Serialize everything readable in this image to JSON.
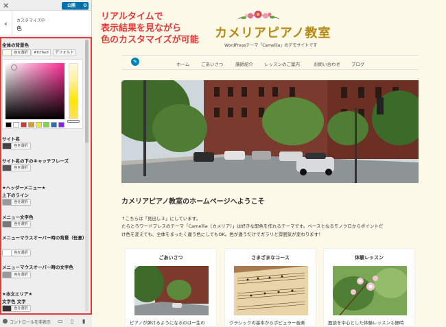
{
  "customizer": {
    "publish_label": "公開",
    "breadcrumb": "カスタマイズ中",
    "section_title": "色",
    "collapse_label": "コントロールを非表示",
    "picker_swatch_label": "色を選択",
    "hex_value": "#fcf9e8",
    "default_label": "デフォルト",
    "palette_colors": [
      "#000000",
      "#ffffff",
      "#dd3333",
      "#dd9933",
      "#eeee22",
      "#81d742",
      "#1e73be",
      "#8224e3"
    ],
    "controls": [
      {
        "label": "全体の背景色",
        "color": "#fcf9e8"
      },
      {
        "label": "サイト名",
        "color": "#444444"
      },
      {
        "label": "サイト名の下のキャッチフレーズ",
        "color": "#555555"
      },
      {
        "label": "★ヘッダーメニュー★",
        "color": null
      },
      {
        "label": "上下のライン",
        "color": "#999999"
      },
      {
        "label": "メニュー文字色",
        "color": "#777777"
      },
      {
        "label": "メニューマウスオーバー時の背景（任意）",
        "color": "#ffffff"
      },
      {
        "label": "メニューマウスオーバー時の文字色",
        "color": "#999999"
      },
      {
        "label": "★本文エリア★",
        "color": null
      },
      {
        "label": "文字色 文字",
        "color": "#333333"
      }
    ]
  },
  "annotation": [
    "リアルタイムで",
    "表示結果を見ながら",
    "色のカスタマイズが可能"
  ],
  "site": {
    "title": "カメリアピアノ教室",
    "tagline": "WordPressテーマ「Camellia」のデモサイトです",
    "nav": [
      "ホーム",
      "ごあいさつ",
      "講師紹介",
      "レッスンのご案内",
      "お問い合わせ",
      "ブログ"
    ],
    "welcome": "カメリアピアノ教室のホームページへようこそ",
    "paragraph1": "↑こちらは「見出し３」にしています。",
    "paragraph2": "たらとろワードプレスのテーマ「Camellia（カメリア）」は好きな配色を作れるテーマです。ベースとなるモノクロからポイントだ",
    "paragraph3": "け色を変えても、全体をまったく違う色にしてもOK。色が違うだけでガラリと雰囲気が変わります！",
    "cards": [
      {
        "title": "ごあいさつ",
        "text": "ピアノが弾けるようになるのは一生の"
      },
      {
        "title": "さまざまなコース",
        "text": "クラシックの基本からポピュラー音楽"
      },
      {
        "title": "体験レッスン",
        "text": "面談を中心とした体験レッスンも随時"
      }
    ]
  }
}
